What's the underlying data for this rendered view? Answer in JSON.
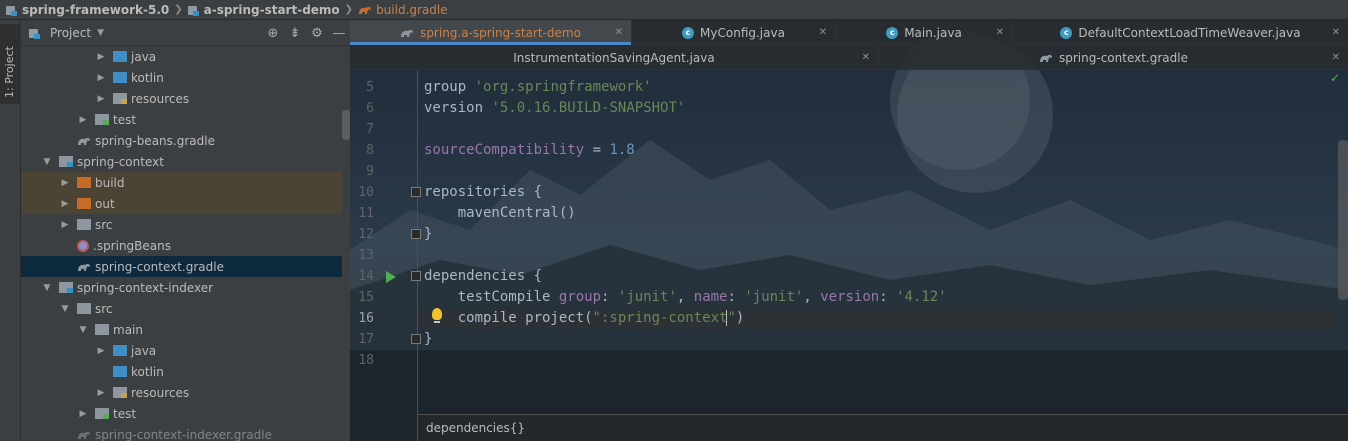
{
  "breadcrumb": {
    "items": [
      "spring-framework-5.0",
      "a-spring-start-demo",
      "build.gradle"
    ]
  },
  "left_strip": {
    "label": "1: Project"
  },
  "project_panel": {
    "title": "Project",
    "tree": [
      {
        "label": "java",
        "icon": "folder-blue",
        "expanded": false,
        "style": "normal"
      },
      {
        "label": "kotlin",
        "icon": "folder-blue",
        "expanded": false,
        "style": "normal"
      },
      {
        "label": "resources",
        "icon": "folder-resources",
        "expanded": false,
        "style": "normal"
      },
      {
        "label": "test",
        "icon": "folder-test",
        "expanded": false,
        "style": "normal"
      },
      {
        "label": "spring-beans.gradle",
        "icon": "gradle-file",
        "expanded": null,
        "style": "normal"
      },
      {
        "label": "spring-context",
        "icon": "module-folder",
        "expanded": true,
        "style": "normal"
      },
      {
        "label": "build",
        "icon": "folder-excluded",
        "expanded": false,
        "style": "excluded"
      },
      {
        "label": "out",
        "icon": "folder-excluded",
        "expanded": false,
        "style": "excluded"
      },
      {
        "label": "src",
        "icon": "folder",
        "expanded": false,
        "style": "normal"
      },
      {
        "label": ".springBeans",
        "icon": "spring-beans-file",
        "expanded": null,
        "style": "normal"
      },
      {
        "label": "spring-context.gradle",
        "icon": "gradle-file",
        "expanded": null,
        "style": "selected"
      },
      {
        "label": "spring-context-indexer",
        "icon": "module-folder",
        "expanded": true,
        "style": "normal"
      },
      {
        "label": "src",
        "icon": "folder",
        "expanded": true,
        "style": "normal"
      },
      {
        "label": "main",
        "icon": "folder",
        "expanded": true,
        "style": "normal"
      },
      {
        "label": "java",
        "icon": "folder-blue",
        "expanded": false,
        "style": "normal"
      },
      {
        "label": "kotlin",
        "icon": "folder-blue",
        "expanded": null,
        "style": "normal"
      },
      {
        "label": "resources",
        "icon": "folder-resources",
        "expanded": false,
        "style": "normal"
      },
      {
        "label": "test",
        "icon": "folder-test",
        "expanded": false,
        "style": "normal"
      },
      {
        "label": "spring-context-indexer.gradle",
        "icon": "gradle-file",
        "expanded": null,
        "style": "faded"
      }
    ]
  },
  "editor_tabs": {
    "row1": [
      {
        "label": "spring.a-spring-start-demo",
        "icon": "gradle-icon",
        "active": true
      },
      {
        "label": "MyConfig.java",
        "icon": "class-icon",
        "active": false
      },
      {
        "label": "Main.java",
        "icon": "class-icon",
        "active": false
      },
      {
        "label": "DefaultContextLoadTimeWeaver.java",
        "icon": "class-icon",
        "active": false
      }
    ],
    "row2": [
      {
        "label": "InstrumentationSavingAgent.java",
        "icon": "none",
        "active": false
      },
      {
        "label": "spring-context.gradle",
        "icon": "gradle-icon",
        "active": false
      }
    ]
  },
  "code": {
    "line_numbers": [
      "5",
      "6",
      "7",
      "8",
      "9",
      "10",
      "11",
      "12",
      "13",
      "14",
      "15",
      "16",
      "17",
      "18"
    ],
    "current_line": "16",
    "lines": [
      {
        "n": "5",
        "group_kw": "group",
        "group_val": "'org.springframework'"
      },
      {
        "n": "6",
        "version_kw": "version",
        "version_val": "'5.0.16.BUILD-SNAPSHOT'"
      },
      {
        "n": "8",
        "prop": "sourceCompatibility",
        "op": " = ",
        "val": "1.8"
      },
      {
        "n": "10",
        "text": "repositories {"
      },
      {
        "n": "11",
        "text": "    mavenCentral()"
      },
      {
        "n": "12",
        "text": "}"
      },
      {
        "n": "14",
        "text": "dependencies {"
      },
      {
        "n": "15",
        "kw": "testCompile",
        "g": "group",
        "gv": "'junit'",
        "nm": "name",
        "nv": "'junit'",
        "vs": "version",
        "vv": "'4.12'"
      },
      {
        "n": "16",
        "kw": "compile project(",
        "s1": "\":spring-context",
        "s2": "\"",
        "tail": ")"
      },
      {
        "n": "17",
        "text": "}"
      }
    ]
  },
  "editor_breadcrumb": "dependencies{}",
  "status_check": "✓",
  "colors": {
    "accent": "#4a88c7",
    "string": "#6a8759",
    "property": "#9876aa",
    "number": "#6897bb",
    "excluded_row": "#4b4435",
    "selected_row": "#0d293e"
  }
}
